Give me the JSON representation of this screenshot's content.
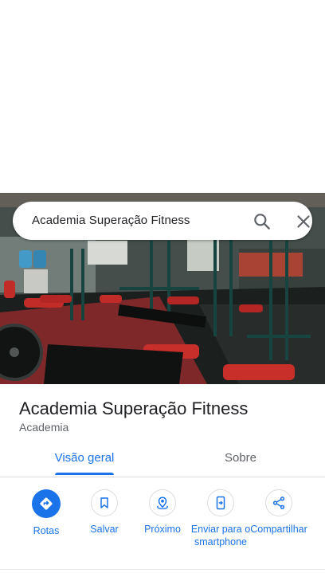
{
  "search": {
    "query": "Academia Superação Fitness"
  },
  "place": {
    "title": "Academia Superação Fitness",
    "category": "Academia"
  },
  "tabs": [
    {
      "label": "Visão geral",
      "active": true
    },
    {
      "label": "Sobre",
      "active": false
    }
  ],
  "actions": [
    {
      "label": "Rotas",
      "icon": "directions-icon"
    },
    {
      "label": "Salvar",
      "icon": "bookmark-icon"
    },
    {
      "label": "Próximo",
      "icon": "nearby-icon"
    },
    {
      "label": "Enviar para o smartphone",
      "icon": "send-to-phone-icon"
    },
    {
      "label": "Compartilhar",
      "icon": "share-icon"
    }
  ],
  "colors": {
    "accent": "#1a73e8",
    "text_primary": "#202124",
    "text_secondary": "#5f6368",
    "divider": "#dadce0"
  }
}
